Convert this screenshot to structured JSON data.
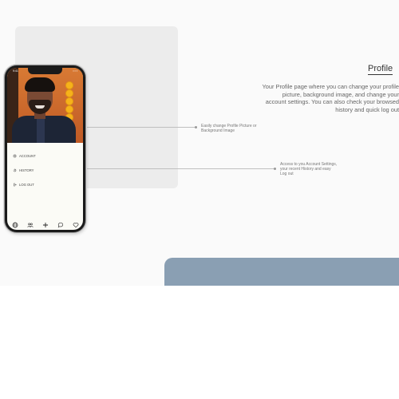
{
  "page": {
    "title": "Profile",
    "description": [
      "Your Profile page where you can change your profile",
      "picture, background image, and change your",
      "account settings. You can also check your browsed",
      "history and quick log out"
    ]
  },
  "annotations": {
    "picture": [
      "Easily change Profile Picture or",
      "Background Image"
    ],
    "settings": [
      "Access to you Account Settings,",
      "your recent History and easy",
      "Log out"
    ]
  },
  "phone": {
    "status_time": "9:41",
    "status_right": "▪ ▪ ▪",
    "menu": [
      {
        "label": "ACCOUNT",
        "icon": "gear-icon"
      },
      {
        "label": "HISTORY",
        "icon": "history-icon"
      },
      {
        "label": "LOG OUT",
        "icon": "logout-icon"
      }
    ],
    "tabs": [
      "globe-icon",
      "community-icon",
      "add-icon",
      "chat-icon",
      "heart-icon"
    ]
  },
  "colors": {
    "accent_band": "#8a9fb3",
    "card": "#ececec"
  }
}
